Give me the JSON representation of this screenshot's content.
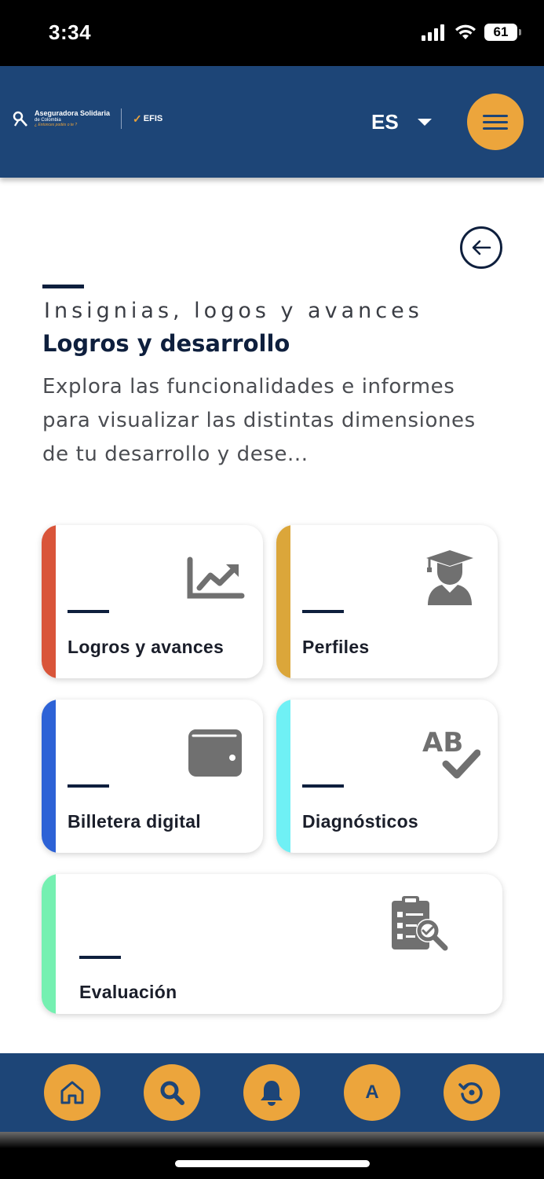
{
  "status_bar": {
    "time": "3:34",
    "battery": "61"
  },
  "header": {
    "logo": {
      "line1": "Aseguradora Solidaria",
      "line2": "de Colombia",
      "line3": "¿ Entonces podés o te ?",
      "efis": "EFIS"
    },
    "language": "ES"
  },
  "intro": {
    "eyebrow": "Insignias, logos y avances",
    "title": "Logros y desarrollo",
    "description": "Explora las funcionalidades e informes para visualizar las distintas dimensiones de tu desarrollo y dese..."
  },
  "cards": [
    {
      "label": "Logros y avances",
      "icon": "chart-line-icon",
      "accent": "#d9553a"
    },
    {
      "label": "Perfiles",
      "icon": "graduate-user-icon",
      "accent": "#dba63a"
    },
    {
      "label": "Billetera digital",
      "icon": "wallet-icon",
      "accent": "#2d62d6"
    },
    {
      "label": "Diagnósticos",
      "icon": "spell-check-icon",
      "accent": "#6ff0f5"
    },
    {
      "label": "Evaluación",
      "icon": "clipboard-search-icon",
      "accent": "#75f0b1"
    }
  ],
  "bottom_nav": {
    "items": [
      "home-icon",
      "search-icon",
      "bell-icon",
      "accessibility-a-icon",
      "history-icon"
    ],
    "a_label": "A"
  },
  "colors": {
    "primary": "#1d4577",
    "accent": "#eca53c",
    "dark_text": "#0e1f3d"
  }
}
